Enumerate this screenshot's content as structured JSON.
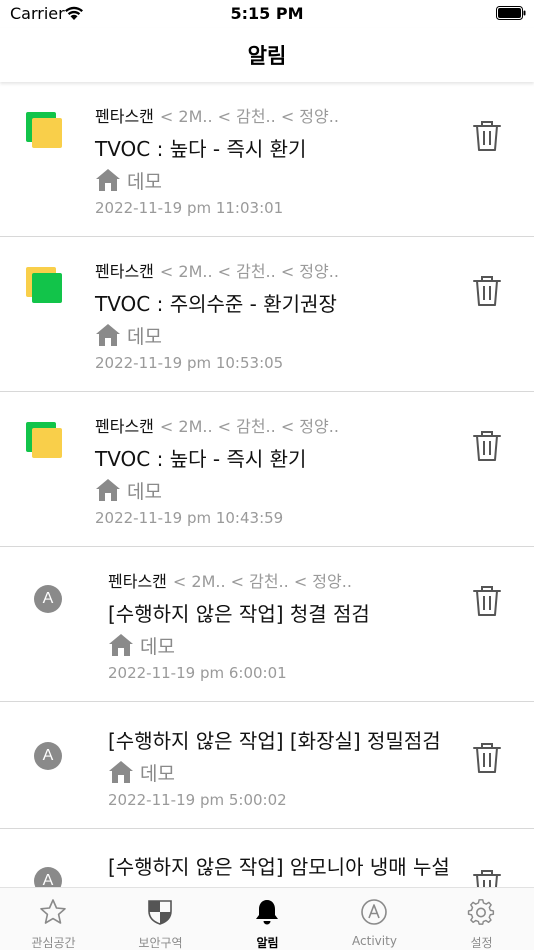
{
  "status": {
    "carrier": "Carrier",
    "time": "5:15 PM"
  },
  "nav": {
    "title": "알림"
  },
  "colors": {
    "yellow": "#f9cf4a",
    "green": "#12c44a",
    "gray_icon": "#8a8a8a"
  },
  "alerts": [
    {
      "type": "tvoc",
      "back_color": "#12c44a",
      "front_color": "#f9cf4a",
      "crumb_main": "펜타스캔",
      "crumb_sub": "< 2M..  < 감천..  < 정양..",
      "title": "TVOC : 높다 - 즉시 환기",
      "place": "데모",
      "time": "2022-11-19 pm 11:03:01",
      "icon": "home-icon"
    },
    {
      "type": "tvoc",
      "back_color": "#f9cf4a",
      "front_color": "#12c44a",
      "crumb_main": "펜타스캔",
      "crumb_sub": "< 2M..  < 감천..  < 정양..",
      "title": "TVOC : 주의수준 - 환기권장",
      "place": "데모",
      "time": "2022-11-19 pm 10:53:05",
      "icon": "home-icon"
    },
    {
      "type": "tvoc",
      "back_color": "#12c44a",
      "front_color": "#f9cf4a",
      "crumb_main": "펜타스캔",
      "crumb_sub": "< 2M..  < 감천..  < 정양..",
      "title": "TVOC : 높다 - 즉시 환기",
      "place": "데모",
      "time": "2022-11-19 pm 10:43:59",
      "icon": "home-icon"
    },
    {
      "type": "activity",
      "badge": "A",
      "crumb_main": "펜타스캔",
      "crumb_sub": "< 2M..  < 감천..  < 정양..",
      "title": "[수행하지 않은 작업] 청결 점검",
      "place": "데모",
      "time": "2022-11-19 pm 6:00:01",
      "icon": "home-icon"
    },
    {
      "type": "activity",
      "badge": "A",
      "title": "[수행하지 않은 작업] [화장실] 정밀점검",
      "place": "데모",
      "time": "2022-11-19 pm 5:00:02",
      "icon": "home-icon"
    },
    {
      "type": "activity",
      "badge": "A",
      "title": "[수행하지 않은 작업] 암모니아 냉매 누설",
      "icon": "home-icon"
    }
  ],
  "tabs": [
    {
      "label": "관심공간",
      "icon": "star-icon",
      "active": false
    },
    {
      "label": "보안구역",
      "icon": "shield-icon",
      "active": false
    },
    {
      "label": "알림",
      "icon": "bell-icon",
      "active": true
    },
    {
      "label": "Activity",
      "icon": "activity-icon",
      "active": false
    },
    {
      "label": "설정",
      "icon": "gear-icon",
      "active": false
    }
  ]
}
